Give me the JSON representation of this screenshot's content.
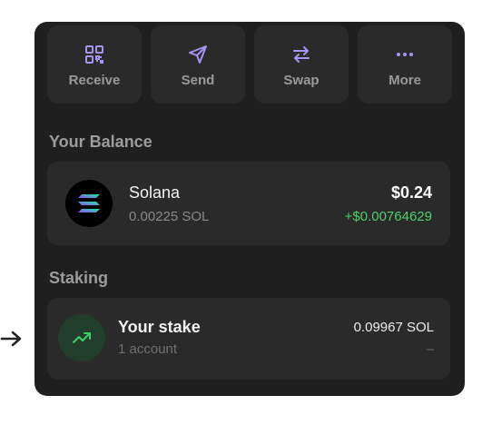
{
  "colors": {
    "panel_bg": "#1f1f1f",
    "card_bg": "#2a2a2a",
    "accent_purple": "#a693f2",
    "positive_green": "#4fd06a"
  },
  "actions": [
    {
      "label": "Receive",
      "icon": "qr-code-icon"
    },
    {
      "label": "Send",
      "icon": "send-icon"
    },
    {
      "label": "Swap",
      "icon": "swap-icon"
    },
    {
      "label": "More",
      "icon": "more-icon"
    }
  ],
  "balance": {
    "title": "Your Balance",
    "token": {
      "name": "Solana",
      "amount": "0.00225 SOL",
      "value": "$0.24",
      "change": "+$0.00764629",
      "icon": "solana-logo-icon"
    }
  },
  "staking": {
    "title": "Staking",
    "stake": {
      "title": "Your stake",
      "subtitle": "1 account",
      "value": "0.09967 SOL",
      "change": "–",
      "icon": "trending-up-icon"
    }
  },
  "indicator_icon": "arrow-right-icon"
}
